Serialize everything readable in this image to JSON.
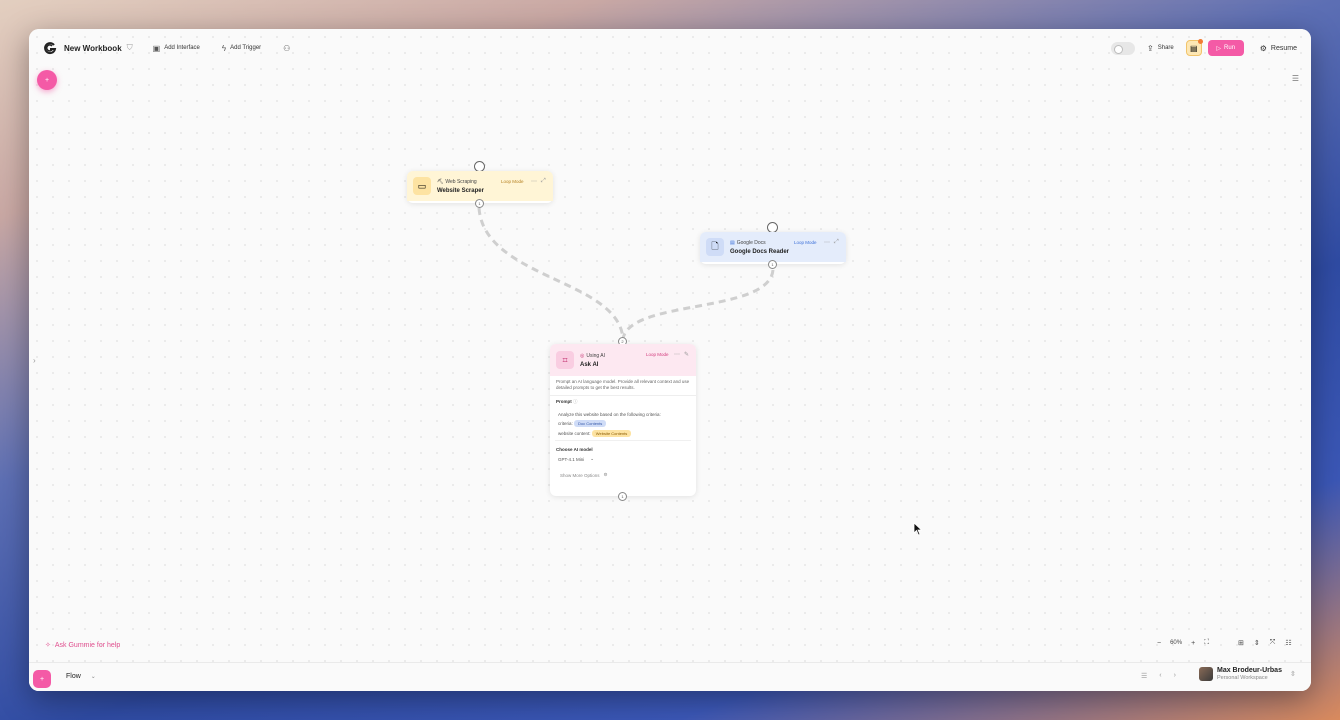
{
  "header": {
    "title": "New Workbook",
    "add_interface": "Add Interface",
    "add_trigger": "Add Trigger",
    "share": "Share",
    "run": "Run",
    "resume": "Resume"
  },
  "nodes": {
    "scraper": {
      "category": "Web Scraping",
      "name": "Website Scraper",
      "loop": "Loop Mode",
      "out_port": "1",
      "accent": "#fff5d6",
      "icon": "monitor-icon"
    },
    "docs": {
      "category": "Google Docs",
      "name": "Google Docs Reader",
      "loop": "Loop Mode",
      "out_port": "1",
      "accent": "#e4ecfb",
      "icon": "document-icon"
    },
    "ask_ai": {
      "category": "Using AI",
      "name": "Ask AI",
      "loop": "Loop Mode",
      "in_port": "2",
      "out_port": "1",
      "accent": "#fde8f1",
      "icon": "chip-icon",
      "description": "Prompt an AI language model. Provide all relevant context and use detailed prompts to get the best results.",
      "prompt_label": "Prompt",
      "prompt_line1": "Analyze this website based on the following criteria:",
      "criteria_label": "criteria:",
      "criteria_chip": "Doc Contents",
      "content_label": "website content:",
      "content_chip": "Website Contents",
      "model_label": "Choose AI model",
      "model_value": "GPT-4.1 Mini",
      "more_options": "Show More Options"
    }
  },
  "footer": {
    "ask_gummie": "Ask Gummie for help",
    "zoom": "60%",
    "flow": "Flow",
    "user_name": "Max Brodeur-Urbas",
    "workspace": "Personal Workspace"
  },
  "colors": {
    "accent_pink": "#f45aa6",
    "edge": "#cfcfcf"
  }
}
